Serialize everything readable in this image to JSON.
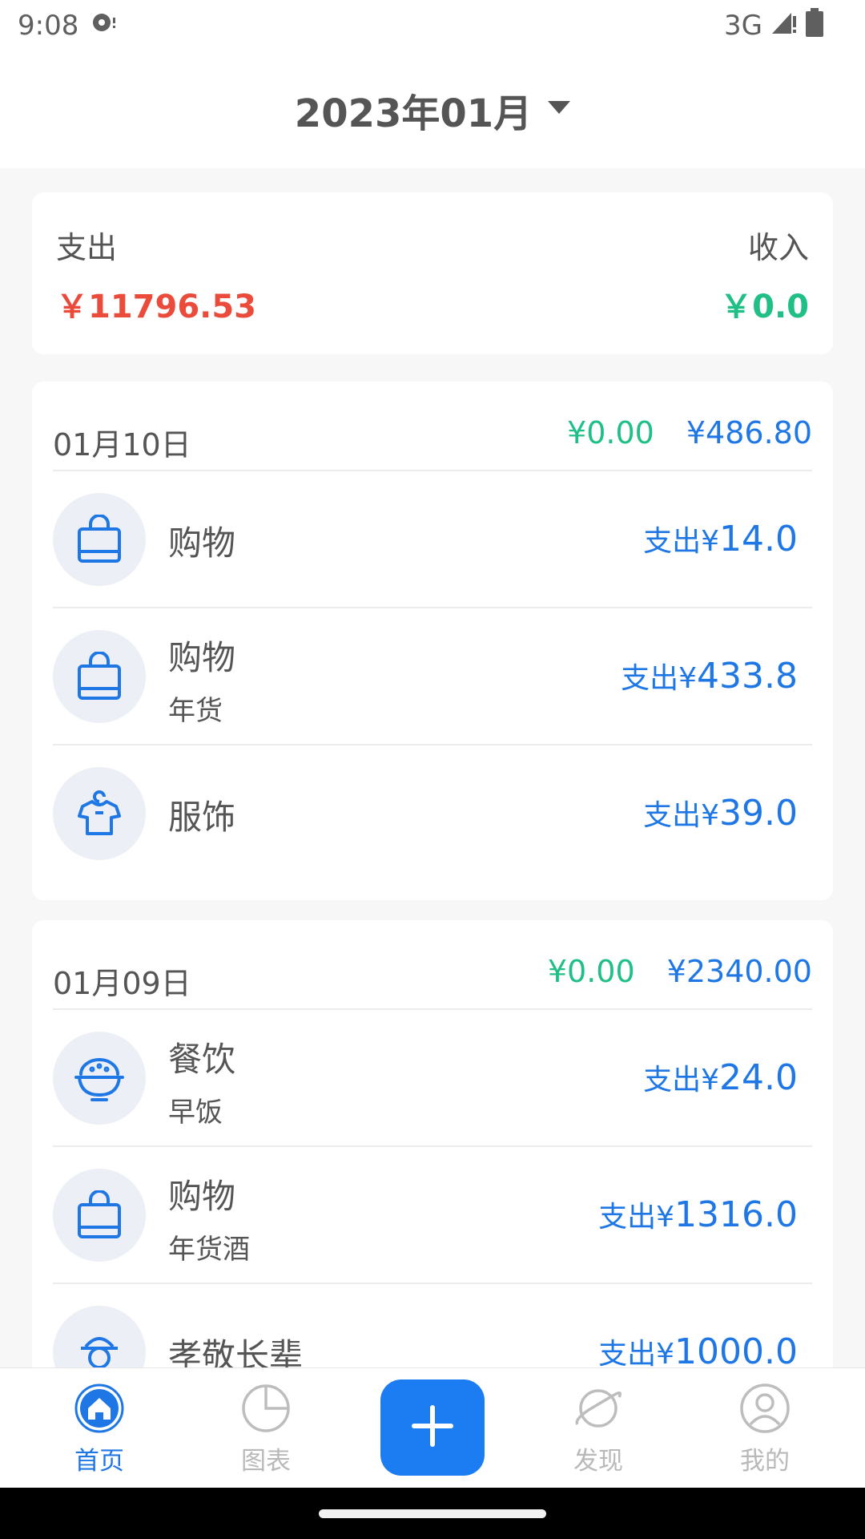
{
  "status_bar": {
    "time": "9:08",
    "network": "3G"
  },
  "header": {
    "month": "2023年01月"
  },
  "summary": {
    "expense_label": "支出",
    "expense_amount": "￥11796.53",
    "income_label": "收入",
    "income_amount": "￥0.0"
  },
  "days": [
    {
      "date": "01月10日",
      "income_total": "¥0.00",
      "expense_total": "¥486.80",
      "entries": [
        {
          "category": "购物",
          "note": "",
          "prefix": "支出¥",
          "amount": "14.0",
          "icon": "shopping-bag-icon"
        },
        {
          "category": "购物",
          "note": "年货",
          "prefix": "支出¥",
          "amount": "433.8",
          "icon": "shopping-bag-icon"
        },
        {
          "category": "服饰",
          "note": "",
          "prefix": "支出¥",
          "amount": "39.0",
          "icon": "clothes-hanger-icon"
        }
      ]
    },
    {
      "date": "01月09日",
      "income_total": "¥0.00",
      "expense_total": "¥2340.00",
      "entries": [
        {
          "category": "餐饮",
          "note": "早饭",
          "prefix": "支出¥",
          "amount": "24.0",
          "icon": "rice-bowl-icon"
        },
        {
          "category": "购物",
          "note": "年货酒",
          "prefix": "支出¥",
          "amount": "1316.0",
          "icon": "shopping-bag-icon"
        },
        {
          "category": "孝敬长辈",
          "note": "",
          "prefix": "支出¥",
          "amount": "1000.0",
          "icon": "elder-icon"
        }
      ]
    }
  ],
  "nav": {
    "home": "首页",
    "charts": "图表",
    "discover": "发现",
    "mine": "我的"
  },
  "colors": {
    "accent": "#1e77e5",
    "expense": "#ea4b3b",
    "income": "#1fbf86"
  }
}
